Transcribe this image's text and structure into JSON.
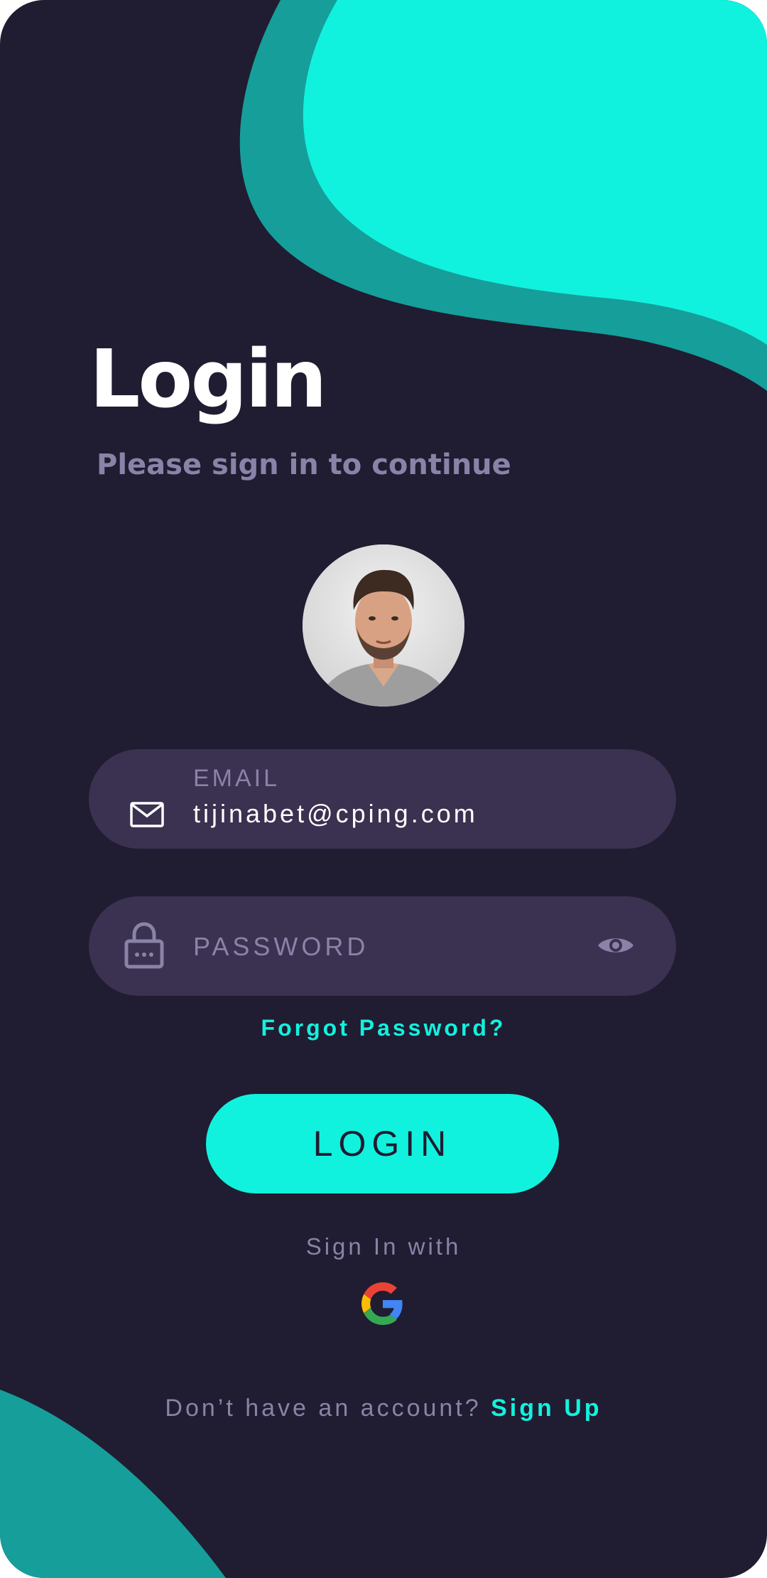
{
  "login": {
    "title": "Login",
    "subtitle": "Please sign in to continue",
    "email": {
      "label": "EMAIL",
      "value": "tijinabet@cping.com"
    },
    "password": {
      "placeholder": "PASSWORD"
    },
    "forgot_password": "Forgot Password?",
    "login_button": "LOGIN",
    "sign_in_with": "Sign In with",
    "footer": {
      "prompt": "Don’t have an account?",
      "signup_link": "Sign Up"
    }
  },
  "icons": {
    "email": "mail-icon",
    "password": "lock-icon",
    "toggle_visibility": "eye-icon",
    "social": "google-icon",
    "profile": "avatar"
  },
  "colors": {
    "background": "#201c31",
    "accent": "#11f2de",
    "accent_dark": "#169e9a",
    "field_background": "#3b3150",
    "muted_text": "#8a83a8",
    "text": "#ffffff"
  }
}
